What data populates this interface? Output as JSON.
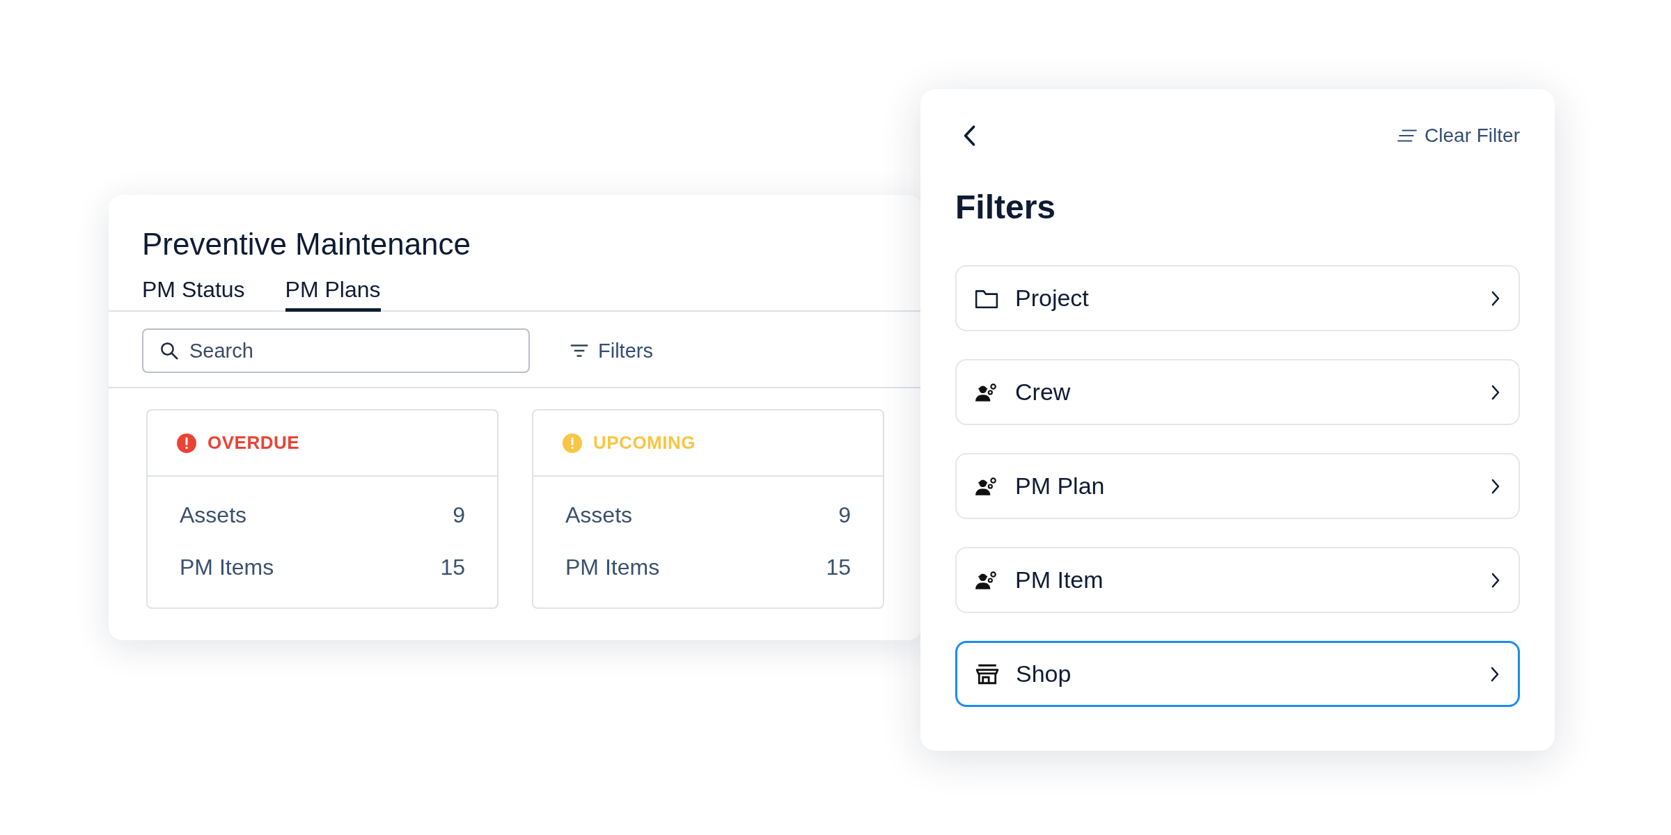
{
  "page": {
    "title": "Preventive Maintenance"
  },
  "tabs": [
    {
      "label": "PM Status",
      "selected": false
    },
    {
      "label": "PM Plans",
      "selected": true
    }
  ],
  "search": {
    "placeholder": "Search"
  },
  "filters_button": {
    "label": "Filters"
  },
  "status_cards": [
    {
      "label": "OVERDUE",
      "color": "#ea4335",
      "rows": [
        {
          "label": "Assets",
          "value": "9"
        },
        {
          "label": "PM Items",
          "value": "15"
        }
      ]
    },
    {
      "label": "UPCOMING",
      "color": "#f8c545",
      "rows": [
        {
          "label": "Assets",
          "value": "9"
        },
        {
          "label": "PM Items",
          "value": "15"
        }
      ]
    }
  ],
  "filter_panel": {
    "clear_label": "Clear Filter",
    "title": "Filters",
    "items": [
      {
        "label": "Project",
        "kind": "folder",
        "selected": false
      },
      {
        "label": "Crew",
        "kind": "crew",
        "selected": false
      },
      {
        "label": "PM Plan",
        "kind": "crew",
        "selected": false
      },
      {
        "label": "PM Item",
        "kind": "crew",
        "selected": false
      },
      {
        "label": "Shop",
        "kind": "shop",
        "selected": true
      }
    ]
  }
}
